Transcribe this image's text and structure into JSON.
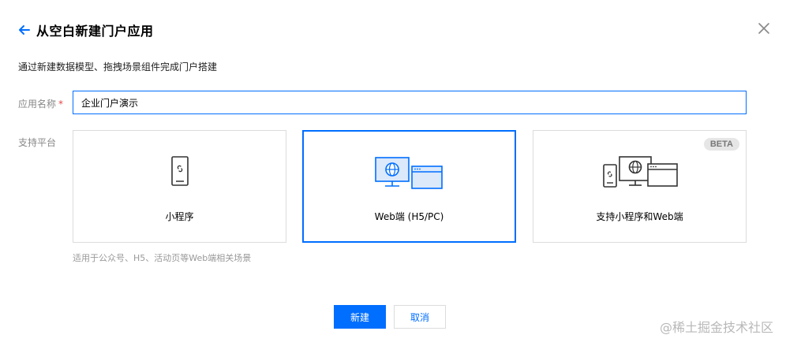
{
  "header": {
    "title": "从空白新建门户应用",
    "back_icon": "arrow-left-icon",
    "close_icon": "close-icon"
  },
  "subtitle": "通过新建数据模型、拖拽场景组件完成门户搭建",
  "form": {
    "name_label": "应用名称",
    "required_mark": "*",
    "name_value": "企业门户演示",
    "platform_label": "支持平台"
  },
  "platforms": [
    {
      "label": "小程序",
      "icon": "mobile-miniprogram-icon",
      "selected": false
    },
    {
      "label": "Web端 (H5/PC)",
      "icon": "web-browser-globe-icon",
      "selected": true
    },
    {
      "label": "支持小程序和Web端",
      "icon": "multi-device-icon",
      "selected": false,
      "badge": "BETA"
    }
  ],
  "hint": "适用于公众号、H5、活动页等Web端相关场景",
  "buttons": {
    "create": "新建",
    "cancel": "取消"
  },
  "watermark": "@稀土掘金技术社区",
  "colors": {
    "accent": "#006eff",
    "required": "#e54545",
    "border": "#dcdcdc"
  }
}
